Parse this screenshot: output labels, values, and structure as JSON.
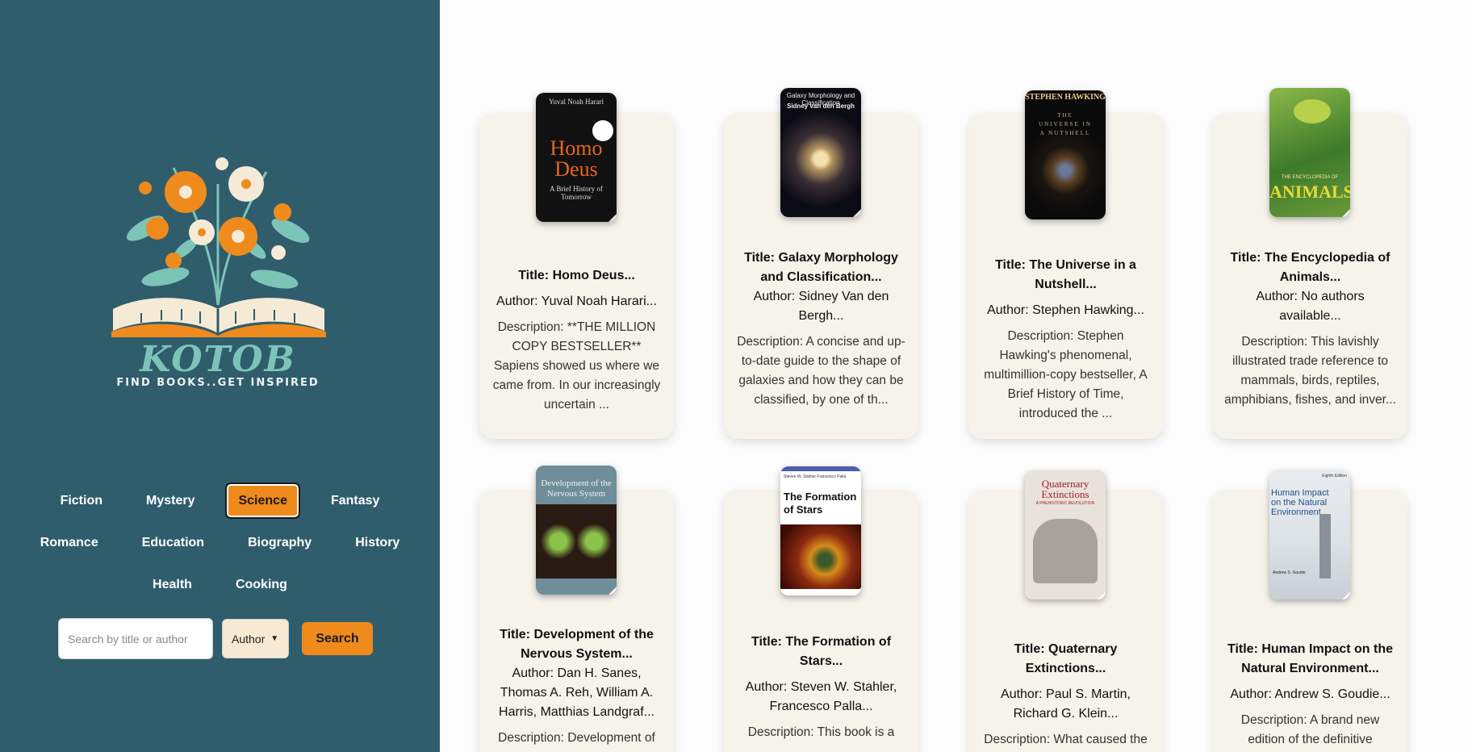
{
  "brand": {
    "name": "KOTOB",
    "tagline": "FIND BOOKS..GET INSPIRED",
    "colors": {
      "sidebar": "#2f5d6c",
      "accent": "#ef8a1d",
      "mint": "#7cc4b8",
      "card": "#f5f3ea"
    }
  },
  "genres": [
    {
      "label": "Fiction",
      "active": false
    },
    {
      "label": "Mystery",
      "active": false
    },
    {
      "label": "Science",
      "active": true
    },
    {
      "label": "Fantasy",
      "active": false
    },
    {
      "label": "Romance",
      "active": false
    },
    {
      "label": "Education",
      "active": false
    },
    {
      "label": "Biography",
      "active": false
    },
    {
      "label": "History",
      "active": false
    },
    {
      "label": "Health",
      "active": false
    },
    {
      "label": "Cooking",
      "active": false
    }
  ],
  "search": {
    "placeholder": "Search by title or author",
    "value": "",
    "filter_selected": "Author",
    "button_label": "Search"
  },
  "books": [
    {
      "title": "Title: Homo Deus...",
      "author": "Author: Yuval Noah Harari...",
      "description": "Description: **THE MILLION COPY BESTSELLER** Sapiens showed us where we came from. In our increasingly uncertain ...",
      "cover": {
        "top_text": "Yuval Noah Harari",
        "main_text": "Homo Deus",
        "sub_text": "A Brief History of Tomorrow",
        "bg": "#111111",
        "accent": "#e8651e"
      }
    },
    {
      "title": "Title: Galaxy Morphology and Classification...",
      "author": "Author: Sidney Van den Bergh...",
      "description": "Description: A concise and up-to-date guide to the shape of galaxies and how they can be classified, by one of th...",
      "cover": {
        "top_text": "Galaxy Morphology and Classification",
        "main_text": "Sidney van den Bergh",
        "sub_text": "",
        "bg": "#0b0b14",
        "accent": "#d9c9a3"
      }
    },
    {
      "title": "Title: The Universe in a Nutshell...",
      "author": "Author: Stephen Hawking...",
      "description": "Description: Stephen Hawking's phenomenal, multimillion-copy bestseller, A Brief History of Time, introduced the ...",
      "cover": {
        "top_text": "STEPHEN HAWKING",
        "main_text": "THE UNIVERSE IN A NUTSHELL",
        "sub_text": "",
        "bg": "#0a0a0a",
        "accent": "#b08a4a"
      }
    },
    {
      "title": "Title: The Encyclopedia of Animals...",
      "author": "Author: No authors available...",
      "description": "Description: This lavishly illustrated trade reference to mammals, birds, reptiles, amphibians, fishes, and inver...",
      "cover": {
        "top_text": "THE ENCYCLOPEDIA OF",
        "main_text": "ANIMALS",
        "sub_text": "",
        "bg": "#4a7a2a",
        "accent": "#d8d25a"
      }
    },
    {
      "title": "Title: Development of the Nervous System...",
      "author": "Author: Dan H. Sanes, Thomas A. Reh, William A. Harris, Matthias Landgraf...",
      "description": "Description: Development of",
      "cover": {
        "top_text": "",
        "main_text": "Development of the Nervous System",
        "sub_text": "",
        "bg": "#6f8e9a",
        "accent": "#e9d27a"
      }
    },
    {
      "title": "Title: The Formation of Stars...",
      "author": "Author: Steven W. Stahler, Francesco Palla...",
      "description": "Description: This book is a",
      "cover": {
        "top_text": "Steven W. Stahler Francesco Palla",
        "main_text": "The Formation of Stars",
        "sub_text": "",
        "bg": "#ffffff",
        "accent": "#c94a15"
      }
    },
    {
      "title": "Title: Quaternary Extinctions...",
      "author": "Author: Paul S. Martin, Richard G. Klein...",
      "description": "Description: What caused the",
      "cover": {
        "top_text": "",
        "main_text": "Quaternary Extinctions",
        "sub_text": "A PREHISTORIC REVOLUTION",
        "bg": "#e8e2da",
        "accent": "#a1202a"
      }
    },
    {
      "title": "Title: Human Impact on the Natural Environment...",
      "author": "Author: Andrew S. Goudie...",
      "description": "Description: A brand new edition of the definitive",
      "cover": {
        "top_text": "Eighth Edition",
        "main_text": "Human Impact on the Natural Environment",
        "sub_text": "Andrew S. Goudie",
        "bg": "#e9ecef",
        "accent": "#1f4f8c"
      }
    }
  ]
}
